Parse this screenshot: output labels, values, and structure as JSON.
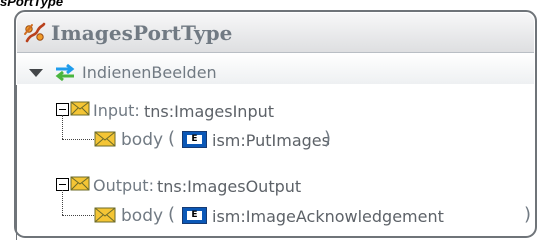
{
  "caption": "sPortType",
  "porttype": {
    "name": "ImagesPortType",
    "icon": "porttype-icon"
  },
  "operation": {
    "name": "IndienenBeelden",
    "expand_icon": "triangle-down-icon",
    "icon": "request-response-arrows-icon"
  },
  "messages": [
    {
      "kind_label": "Input:",
      "message": "tns:ImagesInput",
      "part_label": "body",
      "paren_open": "(",
      "element_badge": "E",
      "element": "ism:PutImages",
      "paren_close": ")"
    },
    {
      "kind_label": "Output:",
      "message": "tns:ImagesOutput",
      "part_label": "body",
      "paren_open": "(",
      "element_badge": "E",
      "element": "ism:ImageAcknowledgement",
      "paren_close": ")"
    }
  ],
  "colors": {
    "title_text": "#717a83",
    "border": "#6f7479",
    "envelope": "#f4c535",
    "envelope_stroke": "#6c6b2a",
    "arrows": "#1e9cec",
    "element_badge": "#0b58b7"
  }
}
